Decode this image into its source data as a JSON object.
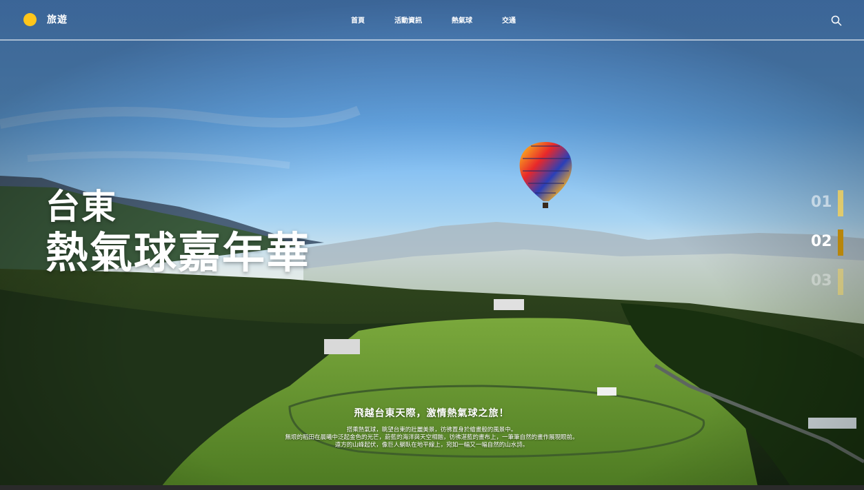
{
  "header": {
    "brand": "旅遊",
    "nav": [
      "首頁",
      "活動資訊",
      "熱氣球",
      "交通"
    ],
    "search_icon": "search-icon"
  },
  "hero": {
    "title_line1": "台東",
    "title_line2": "熱氣球嘉年華",
    "slides": [
      "01",
      "02",
      "03"
    ],
    "active_slide": "02",
    "caption_title": "飛越台東天際，激情熱氣球之旅！",
    "caption_lines": [
      "搭乘熱氣球，眺望台東的壯麗美景，彷彿置身於繪畫般的風景中。",
      "無垠的稻田在晨曦中泛起金色的光芒，蔚藍的海洋與天空相融，彷彿湛藍的畫布上，一筆筆自然的畫作展現眼前。",
      "遠方的山峰起伏，像巨人躺臥在地平線上，宛如一幅又一幅自然的山水詩。"
    ]
  },
  "colors": {
    "accent": "#ffc61a",
    "active_indicator": "#b8860b",
    "sky_top": "#5b9be8",
    "grass": "#5f8f2c"
  }
}
